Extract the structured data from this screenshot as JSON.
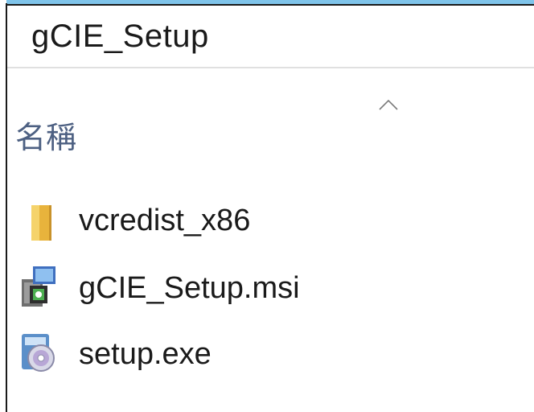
{
  "address_bar": {
    "path": "gCIE_Setup"
  },
  "column_header": {
    "name_label": "名稱",
    "sort_icon": "chevron-up-icon"
  },
  "files": [
    {
      "name": "vcredist_x86",
      "type": "folder",
      "icon": "folder-icon"
    },
    {
      "name": "gCIE_Setup.msi",
      "type": "msi",
      "icon": "msi-installer-icon"
    },
    {
      "name": "setup.exe",
      "type": "exe",
      "icon": "setup-exe-icon"
    }
  ],
  "colors": {
    "accent_border": "#7fc4ea",
    "header_text": "#4d6082",
    "folder": "#f2c94c"
  }
}
